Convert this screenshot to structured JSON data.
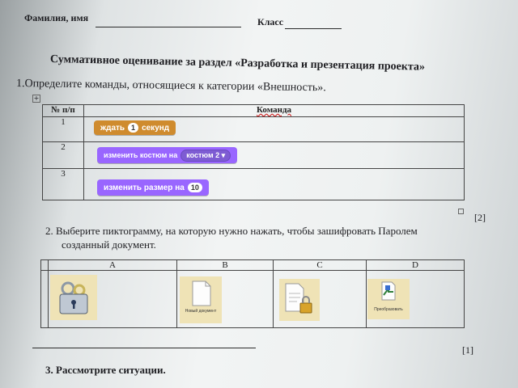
{
  "header": {
    "name_label": "Фамилия, имя",
    "class_label": "Класс",
    "title": "Суммативное оценивание за раздел  «Разработка и презентация проекта»"
  },
  "q1": {
    "text": "1.Определите команды, относящиеся к категории «Внешность».",
    "col_num": "№ п/п",
    "col_cmd": "Команда",
    "score": "[2]",
    "rows": [
      {
        "num": "1",
        "parts": [
          "ждать",
          "1",
          "секунд"
        ],
        "color": "#cf8b2e"
      },
      {
        "num": "2",
        "parts": [
          "изменить костюм на",
          "костюм 2 ▾"
        ],
        "color": "#9966ff"
      },
      {
        "num": "3",
        "parts": [
          "изменить размер на",
          "10"
        ],
        "color": "#9966ff"
      }
    ]
  },
  "q2": {
    "text_line1": "2.  Выберите пиктограмму, на которую нужно нажать, чтобы зашифровать Паролем",
    "text_line2": "созданный документ.",
    "cols": [
      "A",
      "B",
      "C",
      "D"
    ],
    "icons": [
      {
        "name": "lock-keys-icon"
      },
      {
        "name": "new-document-icon",
        "label": "Новый документ"
      },
      {
        "name": "document-lock-icon"
      },
      {
        "name": "convert-icon",
        "label": "Преобразовать"
      }
    ],
    "score": "[1]"
  },
  "q3": {
    "text": "3. Рассмотрите ситуации."
  }
}
